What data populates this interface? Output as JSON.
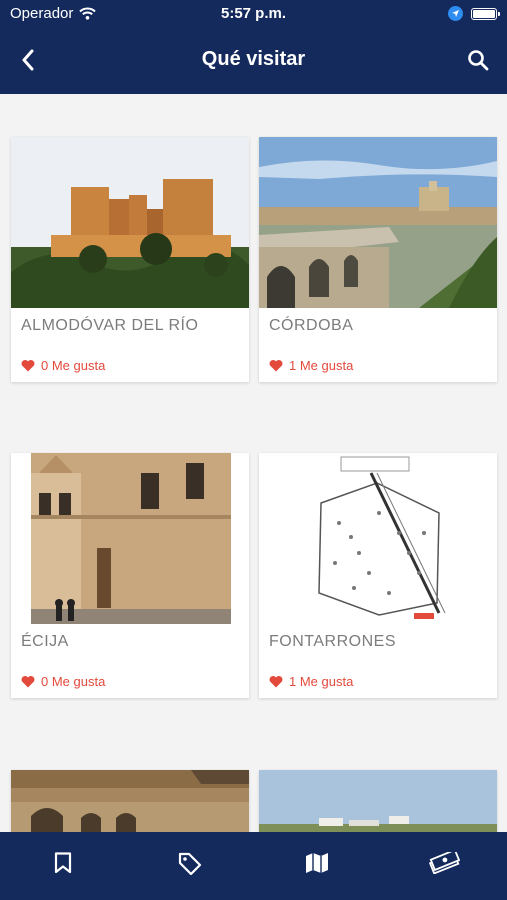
{
  "status": {
    "carrier": "Operador",
    "time": "5:57 p.m."
  },
  "nav": {
    "title": "Qué visitar"
  },
  "icons": {
    "back": "chevron-left-icon",
    "search": "search-icon",
    "like": "heart-icon"
  },
  "colors": {
    "header": "#14295c",
    "accent": "#e44a3c"
  },
  "places": [
    {
      "name": "ALMODÓVAR DEL RÍO",
      "likes": "0 Me gusta"
    },
    {
      "name": "CÓRDOBA",
      "likes": "1 Me gusta"
    },
    {
      "name": "ÉCIJA",
      "likes": "0 Me gusta"
    },
    {
      "name": "FONTARRONES",
      "likes": "1 Me gusta"
    }
  ],
  "tabbar": {
    "items": [
      "bookmark-icon",
      "tag-icon",
      "map-icon",
      "money-icon"
    ]
  }
}
